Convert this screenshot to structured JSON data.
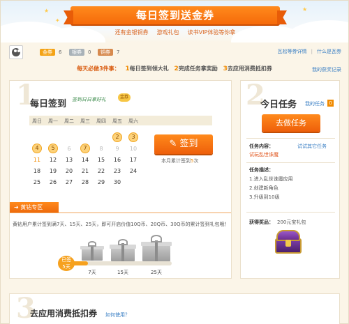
{
  "header": {
    "banner_title": "每日签到送金券",
    "subtitle": [
      "还有金银铜券",
      "游戏礼包",
      "读书VIP体验等你拿"
    ]
  },
  "user": {
    "gold": {
      "label": "金券",
      "value": "6",
      "color": "#f4a316"
    },
    "silver": {
      "label": "银券",
      "value": "0",
      "color": "#a9b2b8"
    },
    "copper": {
      "label": "铜券",
      "value": "7",
      "color": "#d78a4e"
    },
    "links": [
      "瓦松等券详情",
      "什么是瓦券"
    ]
  },
  "must_do": {
    "lead": "每天必做3件事：",
    "items": [
      {
        "num": "1",
        "text": "每日签到领大礼"
      },
      {
        "num": "2",
        "text": "完成任务拿奖励"
      },
      {
        "num": "3",
        "text": "去应用消费抵扣券"
      }
    ],
    "my_rewards": "我的获奖记录"
  },
  "checkin": {
    "number": "1",
    "title": "每日签到",
    "tagline": "签到日日拿好礼",
    "gold_badge": "金券",
    "weekdays": [
      "周日",
      "周一",
      "周二",
      "周三",
      "周四",
      "周五",
      "周六"
    ],
    "rows": [
      [
        "",
        "",
        "",
        "",
        "",
        "2",
        "3"
      ],
      [
        "4",
        "5",
        "6",
        "7",
        "8",
        "9",
        "10"
      ],
      [
        "11",
        "12",
        "13",
        "14",
        "15",
        "16",
        "17"
      ],
      [
        "18",
        "19",
        "20",
        "21",
        "22",
        "23",
        "24"
      ],
      [
        "25",
        "26",
        "27",
        "28",
        "29",
        "30",
        ""
      ]
    ],
    "signed_days": [
      "2",
      "3",
      "4",
      "5",
      "7"
    ],
    "past_days": [
      "6",
      "8",
      "9",
      "10"
    ],
    "today": "11",
    "sign_button": "签到",
    "sign_info_prefix": "本月累计签到",
    "sign_info_count": "5",
    "sign_info_suffix": "次",
    "vip_tag": "黄钻专区",
    "vip_text": "黄钻用户累计签到满7天、15天、25天，即可开启价值10Q币、20Q币、30Q币的累计签到礼包哦！",
    "signed_badge_top": "已签",
    "signed_badge_days": "5天",
    "progress": 0.2,
    "milestones": [
      "7天",
      "15天",
      "25天"
    ]
  },
  "tasks": {
    "number": "2",
    "title": "今日任务",
    "my_tasks": "我的任务",
    "my_tasks_count": "0",
    "do_task_button": "去做任务",
    "content_label": "任务内容：",
    "content_value": "试玩乱世诛魔",
    "try_other": "试试其它任务",
    "desc_label": "任务描述：",
    "desc_items": [
      "1.进入乱世诛魔应用",
      "2.创建新角色",
      "3.升级到10级"
    ],
    "reward_label": "获得奖品：",
    "reward_value": "200元宝礼包"
  },
  "voucher": {
    "number": "3",
    "title": "去应用消费抵扣券",
    "how_to": "如何使用？"
  }
}
